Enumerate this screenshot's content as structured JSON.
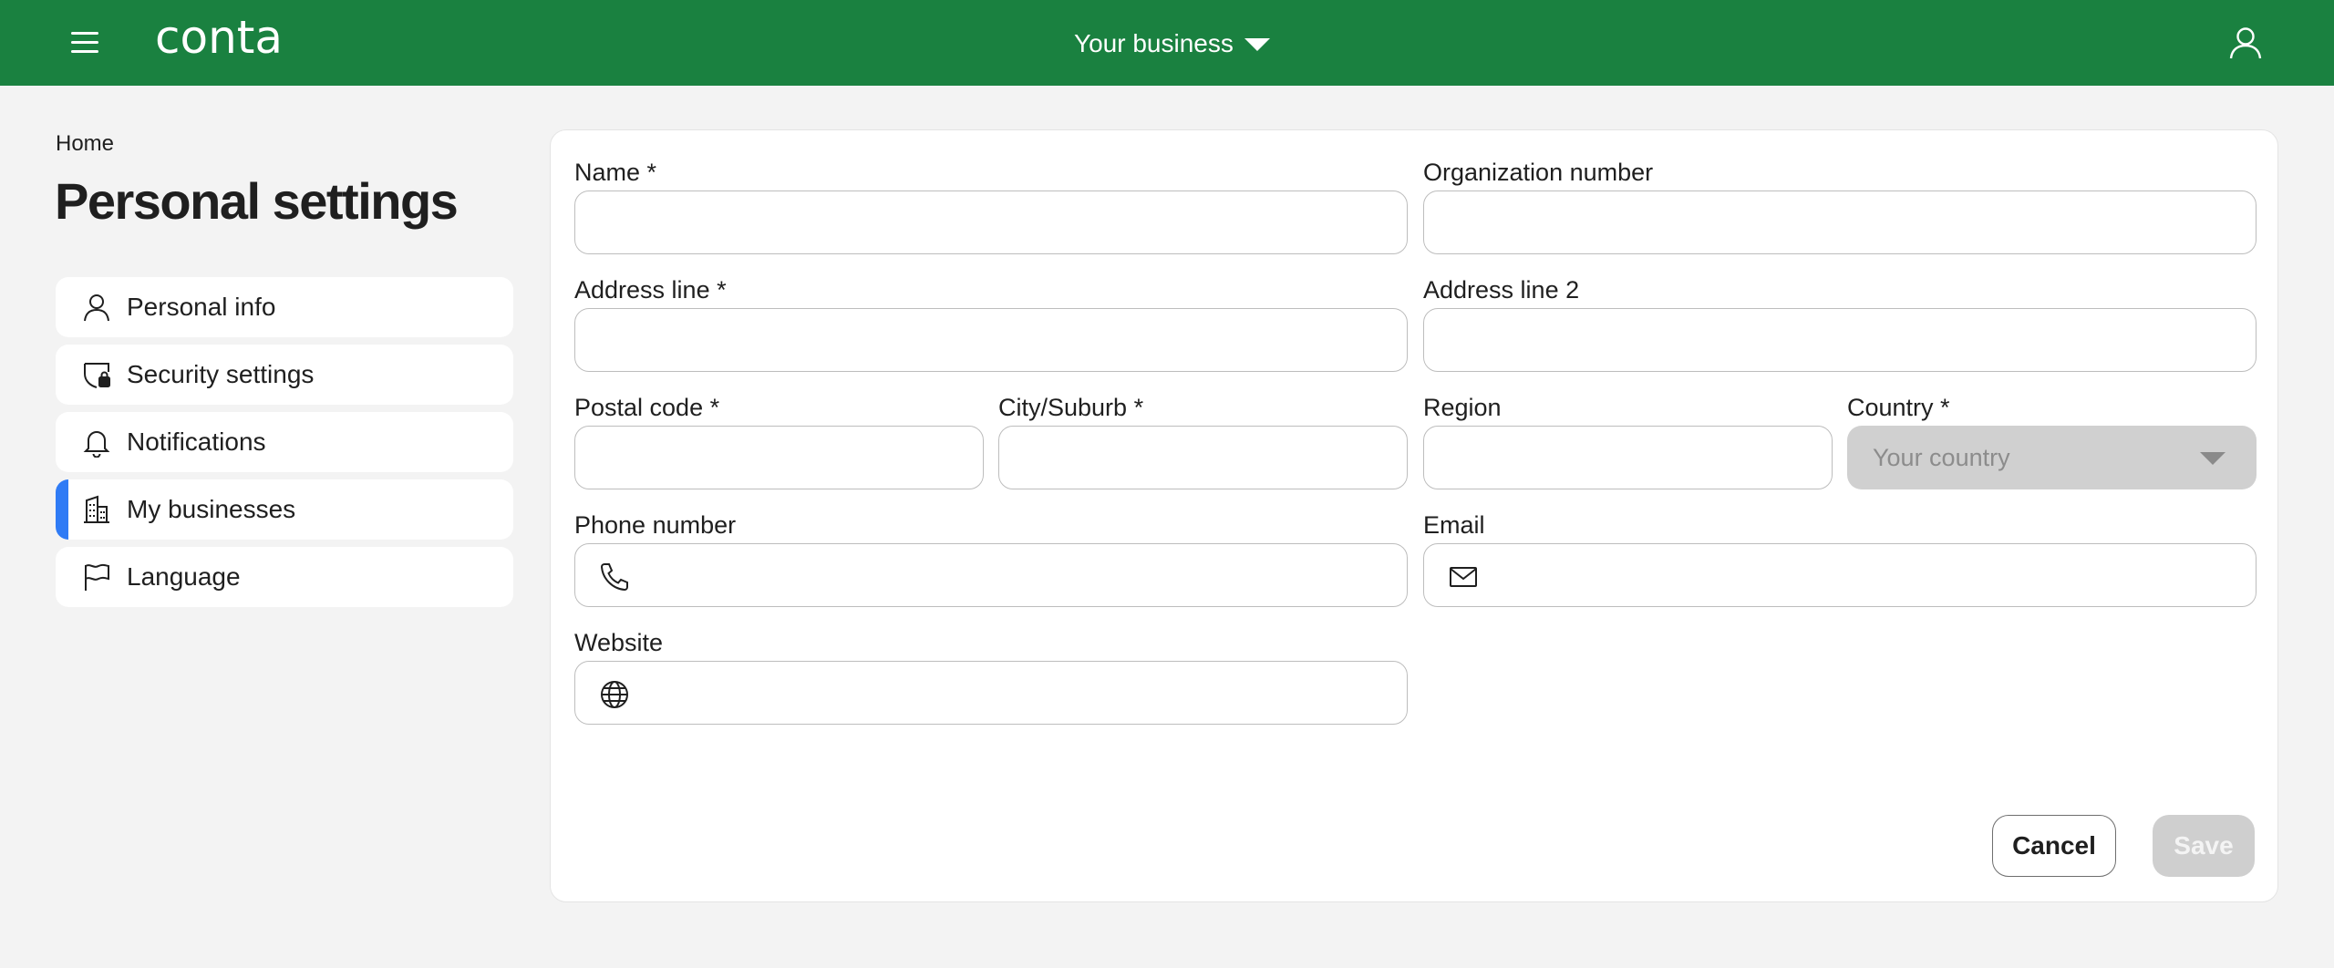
{
  "header": {
    "logo_text": "conta",
    "business_switcher": "Your business"
  },
  "breadcrumb": "Home",
  "page_title": "Personal settings",
  "sidebar": {
    "items": [
      {
        "label": "Personal info",
        "icon": "user-icon",
        "active": false
      },
      {
        "label": "Security settings",
        "icon": "shield-lock-icon",
        "active": false
      },
      {
        "label": "Notifications",
        "icon": "bell-icon",
        "active": false
      },
      {
        "label": "My businesses",
        "icon": "buildings-icon",
        "active": true
      },
      {
        "label": "Language",
        "icon": "flag-icon",
        "active": false
      }
    ]
  },
  "form": {
    "name": {
      "label": "Name *",
      "value": ""
    },
    "org_number": {
      "label": "Organization number",
      "value": ""
    },
    "address1": {
      "label": "Address line *",
      "value": ""
    },
    "address2": {
      "label": "Address line 2",
      "value": ""
    },
    "postal_code": {
      "label": "Postal code *",
      "value": ""
    },
    "city": {
      "label": "City/Suburb *",
      "value": ""
    },
    "region": {
      "label": "Region",
      "value": ""
    },
    "country": {
      "label": "Country *",
      "placeholder": "Your country"
    },
    "phone": {
      "label": "Phone number",
      "icon": "phone-icon",
      "value": ""
    },
    "email": {
      "label": "Email",
      "icon": "envelope-icon",
      "value": ""
    },
    "website": {
      "label": "Website",
      "icon": "globe-icon",
      "value": ""
    }
  },
  "actions": {
    "cancel_label": "Cancel",
    "save_label": "Save"
  },
  "colors": {
    "header_bg": "#1a8140",
    "active_indicator": "#2f7bf5",
    "page_bg": "#f3f3f3",
    "disabled_bg": "#cfcfcf"
  }
}
